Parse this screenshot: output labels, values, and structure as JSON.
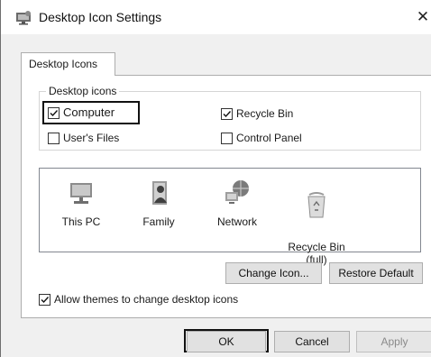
{
  "window": {
    "title": "Desktop Icon Settings",
    "close_glyph": "✕"
  },
  "tabs": [
    {
      "label": "Desktop Icons",
      "selected": true
    }
  ],
  "desktop_icons_group": {
    "legend": "Desktop icons",
    "options": [
      {
        "label": "Computer",
        "checked": true
      },
      {
        "label": "Recycle Bin",
        "checked": true
      },
      {
        "label": "User's Files",
        "checked": false
      },
      {
        "label": "Control Panel",
        "checked": false
      }
    ]
  },
  "icon_list": [
    {
      "label": "This PC",
      "icon": "monitor-icon"
    },
    {
      "label": "Family",
      "icon": "user-folder-icon"
    },
    {
      "label": "Network",
      "icon": "network-icon"
    },
    {
      "label": "Recycle Bin\n(full)",
      "icon": "recycle-bin-full-icon"
    }
  ],
  "actions": {
    "change_icon": "Change Icon...",
    "restore_default": "Restore Default"
  },
  "allow_themes": {
    "label": "Allow themes to change desktop icons",
    "checked": true
  },
  "footer": {
    "ok": "OK",
    "cancel": "Cancel",
    "apply": "Apply"
  },
  "colors": {
    "accent": "#0078d7",
    "window_bg": "#f0f0f0",
    "button_bg": "#e1e1e1"
  }
}
